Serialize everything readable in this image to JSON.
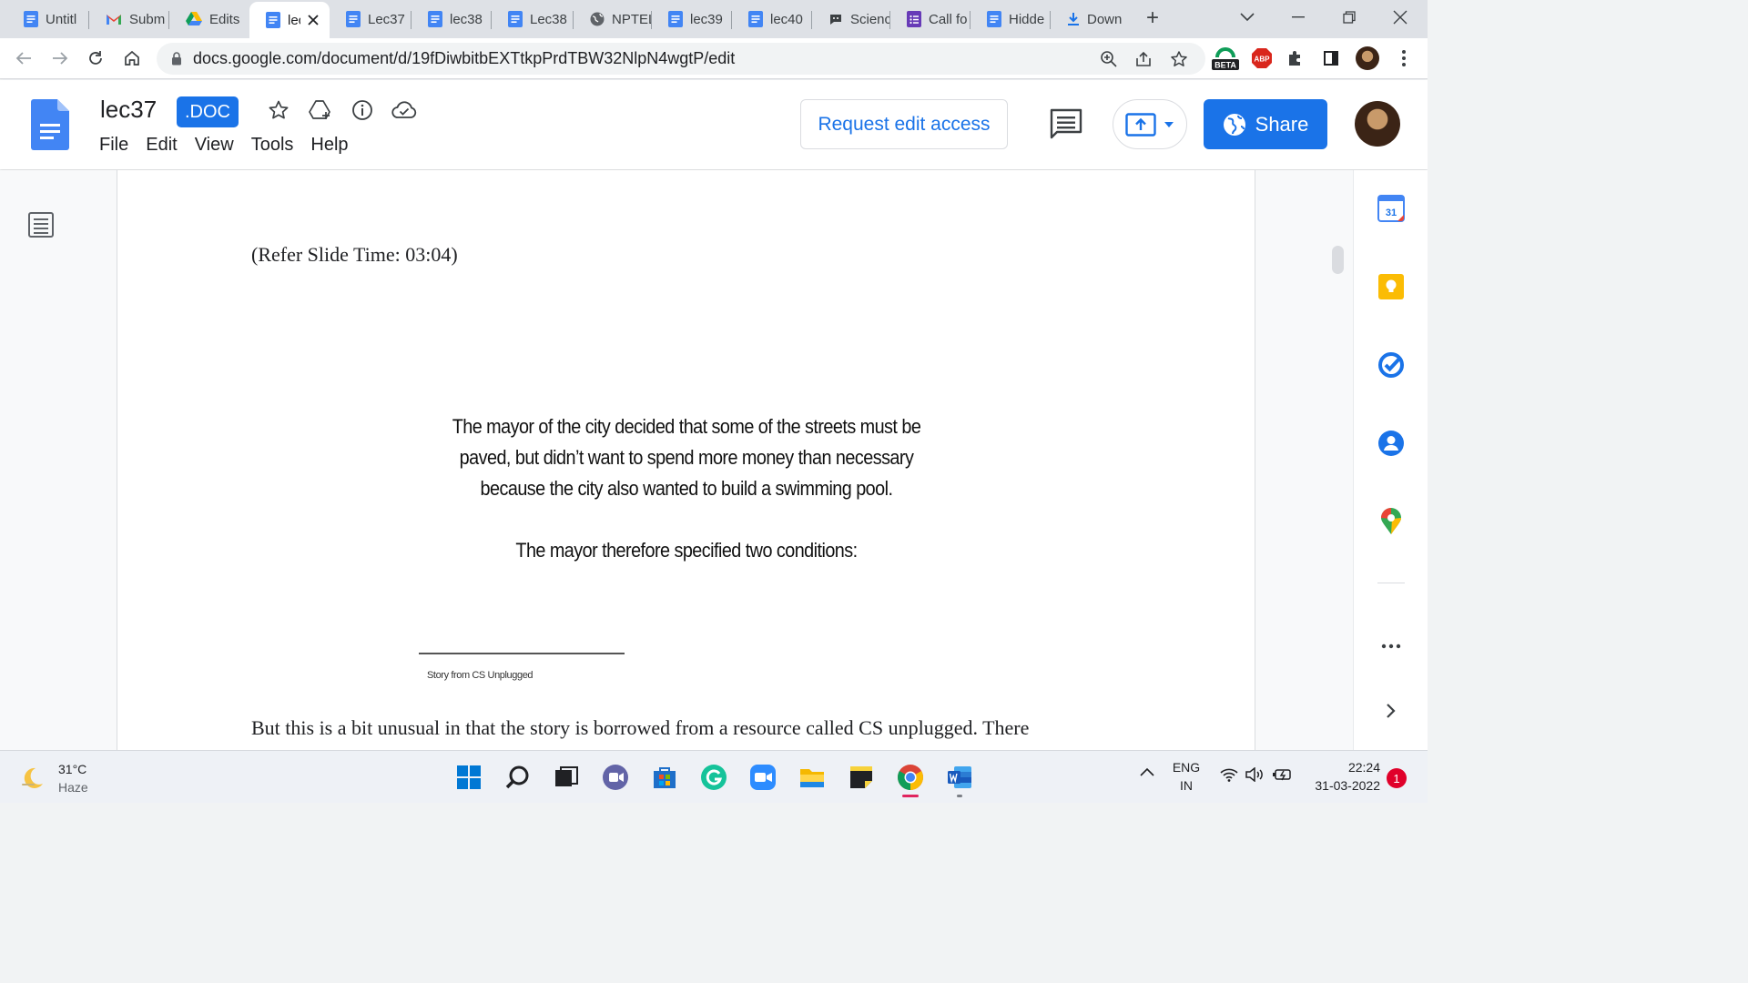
{
  "browser": {
    "tabs": [
      {
        "label": "Untitl",
        "icon": "docs-icon",
        "active": false
      },
      {
        "label": "Subm",
        "icon": "gmail-icon",
        "active": false
      },
      {
        "label": "Edits",
        "icon": "drive-icon",
        "active": false
      },
      {
        "label": "lec",
        "icon": "docs-icon",
        "active": true
      },
      {
        "label": "Lec37",
        "icon": "docs-icon",
        "active": false
      },
      {
        "label": "lec38",
        "icon": "docs-icon",
        "active": false
      },
      {
        "label": "Lec38",
        "icon": "docs-icon",
        "active": false
      },
      {
        "label": "NPTEL",
        "icon": "globe-icon",
        "active": false
      },
      {
        "label": "lec39",
        "icon": "docs-icon",
        "active": false
      },
      {
        "label": "lec40",
        "icon": "docs-icon",
        "active": false
      },
      {
        "label": "Scienc",
        "icon": "chat-icon",
        "active": false
      },
      {
        "label": "Call fo",
        "icon": "forms-icon",
        "active": false
      },
      {
        "label": "Hidde",
        "icon": "docs-icon",
        "active": false
      },
      {
        "label": "Down",
        "icon": "download-icon",
        "active": false
      }
    ],
    "new_tab": "+",
    "address": "docs.google.com/document/d/19fDiwbitbEXTtkpPrdTBW32NlpN4wgtP/edit",
    "extension_beta_label": "BETA",
    "extension_abp_label": "ABP"
  },
  "doc": {
    "title": "lec37",
    "badge": ".DOC",
    "menu": [
      "File",
      "Edit",
      "View",
      "Tools",
      "Help"
    ],
    "request_edit_label": "Request edit access",
    "share_label": "Share"
  },
  "page": {
    "refer_text": "(Refer Slide Time: 03:04)",
    "slide_paragraph_1": "The mayor of the city decided that some of the streets must be paved, but didn’t want to spend more money than necessary because the city also wanted to build a swimming pool.",
    "slide_paragraph_2": "The mayor therefore specified two conditions:",
    "slide_caption": "Story from CS Unplugged",
    "body_text": "But this is a bit unusual in that the story is borrowed from a resource called CS unplugged. There"
  },
  "side_panel": {
    "calendar_day": "31"
  },
  "taskbar": {
    "temperature": "31°C",
    "weather": "Haze",
    "language_line1": "ENG",
    "language_line2": "IN",
    "time": "22:24",
    "date": "31-03-2022",
    "notification_count": "1"
  },
  "colors": {
    "accent": "#1a73e8",
    "docs_blue": "#4285f4"
  }
}
